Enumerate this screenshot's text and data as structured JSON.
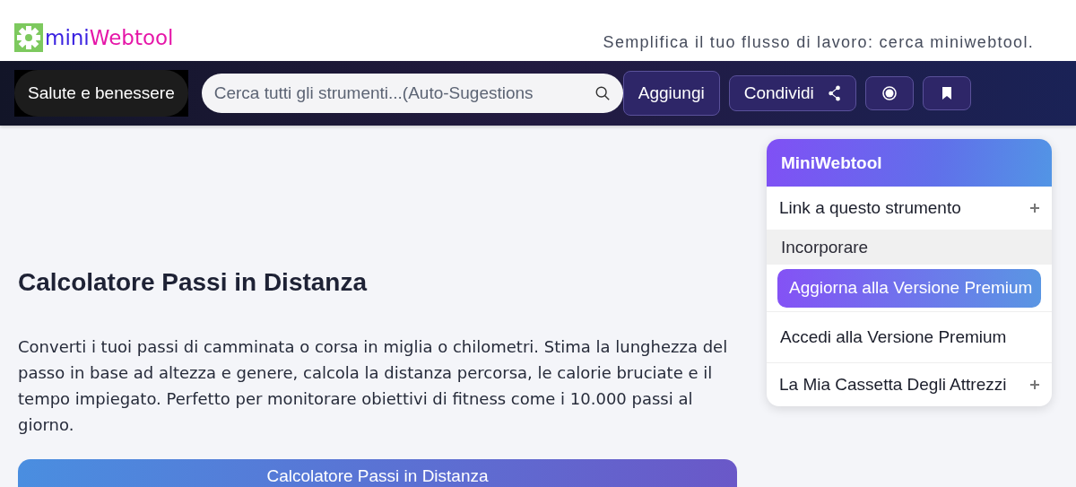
{
  "header": {
    "logo_part_1": "mini",
    "logo_part_2": "Webtool",
    "tagline": "Semplifica il tuo flusso di lavoro: cerca miniwebtool."
  },
  "nav": {
    "category": "Salute e benessere",
    "search": {
      "placeholder": "Cerca tutti gli strumenti...(Auto-Sugestions"
    },
    "add_button": "Aggiungi",
    "share_button": "Condividi"
  },
  "main": {
    "title": "Calcolatore Passi in Distanza",
    "description": "Converti i tuoi passi di camminata o corsa in miglia o chilometri. Stima la lunghezza del passo in base ad altezza e genere, calcola la distanza percorsa, le calorie bruciate e il tempo impiegato. Perfetto per monitorare obiettivi di fitness come i 10.000 passi al giorno.",
    "card_title": "Calcolatore Passi in Distanza"
  },
  "sidebar": {
    "title": "MiniWebtool",
    "items": [
      {
        "kind": "expandable",
        "label": "Link a questo strumento"
      },
      {
        "kind": "subitem",
        "label": "Incorporare"
      },
      {
        "kind": "premium",
        "label": "Aggiorna alla Versione Premium"
      },
      {
        "kind": "plain",
        "label": "Accedi alla Versione Premium"
      },
      {
        "kind": "expandable",
        "label": "La Mia Cassetta Degli Attrezzi"
      }
    ]
  }
}
